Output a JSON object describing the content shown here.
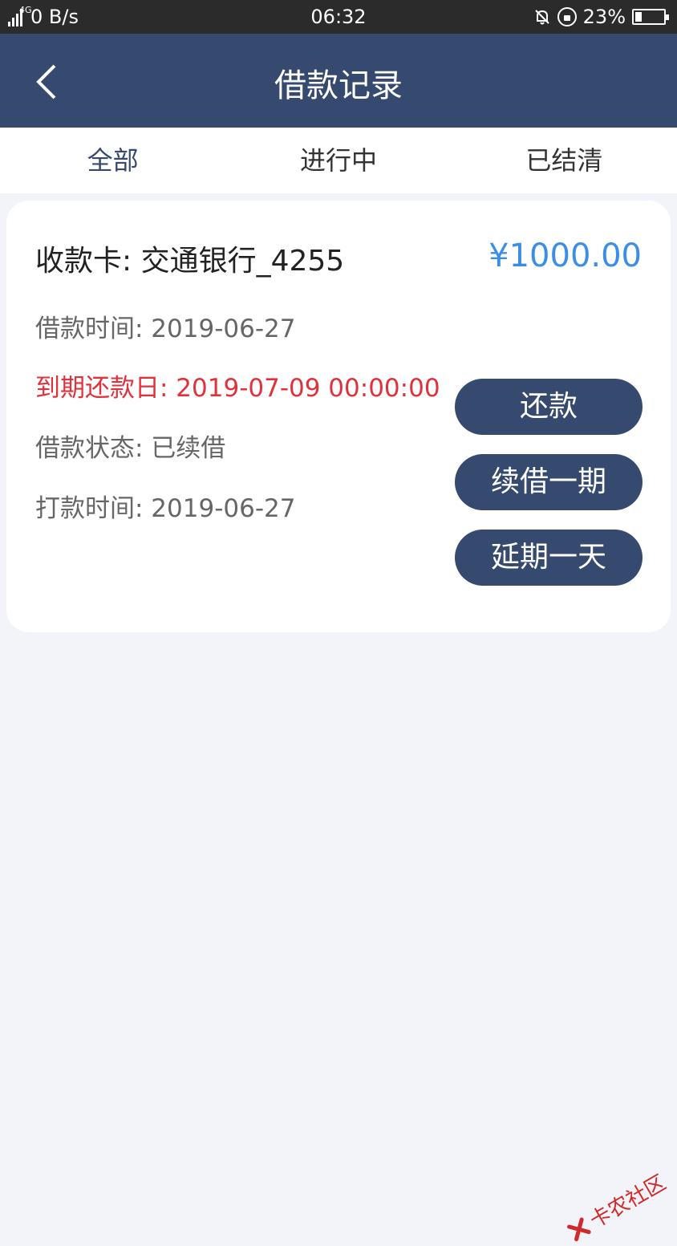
{
  "status_bar": {
    "network_type": "4G",
    "speed": "0 B/s",
    "time": "06:32",
    "battery": "23%",
    "battery_level": 0.23
  },
  "header": {
    "title": "借款记录"
  },
  "tabs": [
    {
      "label": "全部",
      "active": true
    },
    {
      "label": "进行中",
      "active": false
    },
    {
      "label": "已结清",
      "active": false
    }
  ],
  "loan": {
    "card_label": "收款卡: 交通银行_4255",
    "amount": "¥1000.00",
    "loan_time": "借款时间: 2019-06-27",
    "due_date": "到期还款日: 2019-07-09 00:00:00",
    "status": "借款状态: 已续借",
    "payout_time": "打款时间: 2019-06-27",
    "buttons": {
      "repay": "还款",
      "renew": "续借一期",
      "extend": "延期一天"
    }
  },
  "watermark": {
    "text": "卡农社区"
  },
  "colors": {
    "primary": "#364a70",
    "amount": "#3a8ee8",
    "due": "#e0323a",
    "background": "#f2f4f9"
  }
}
